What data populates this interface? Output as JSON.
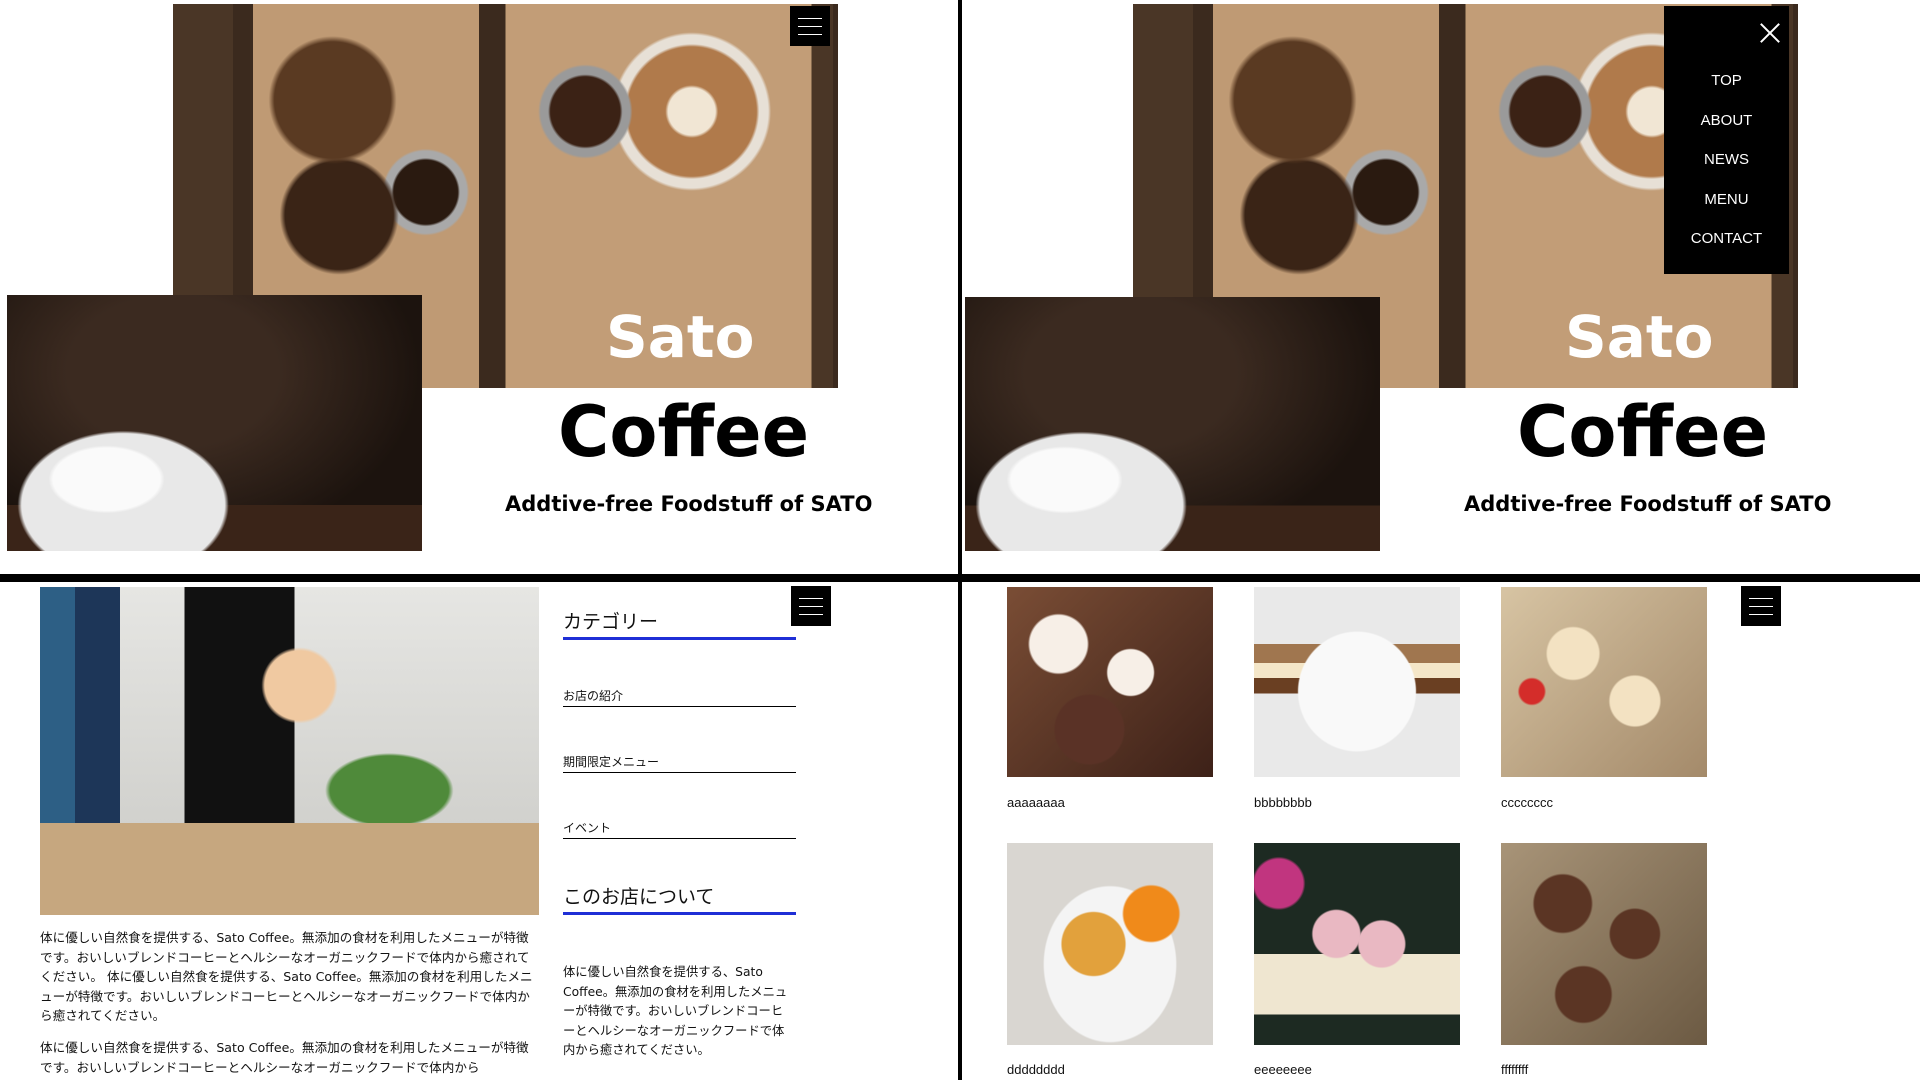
{
  "hero": {
    "title_line1": "Sato",
    "title_line2": "Coffee",
    "tagline": "Addtive-free Foodstuff of SATO"
  },
  "nav": {
    "items": [
      "TOP",
      "ABOUT",
      "NEWS",
      "MENU",
      "CONTACT"
    ]
  },
  "sidebar": {
    "category_heading": "カテゴリー",
    "links": [
      "お店の紹介",
      "期間限定メニュー",
      "イベント"
    ],
    "about_heading": "このお店について",
    "about_text": "体に優しい自然食を提供する、Sato Coffee。無添加の食材を利用したメニューが特徴です。おいしいブレンドコーヒーとヘルシーなオーガニックフードで体内から癒されてください。"
  },
  "article": {
    "paragraph1": "体に優しい自然食を提供する、Sato Coffee。無添加の食材を利用したメニューが特徴です。おいしいブレンドコーヒーとヘルシーなオーガニックフードで体内から癒されてください。 体に優しい自然食を提供する、Sato Coffee。無添加の食材を利用したメニューが特徴です。おいしいブレンドコーヒーとヘルシーなオーガニックフードで体内から癒されてください。",
    "paragraph2": "体に優しい自然食を提供する、Sato Coffee。無添加の食材を利用したメニューが特徴です。おいしいブレンドコーヒーとヘルシーなオーガニックフードで体内から"
  },
  "gallery": {
    "captions": [
      "aaaaaaaa",
      "bbbbbbbb",
      "cccccccc",
      "dddddddd",
      "eeeeeeee",
      "ffffffff"
    ]
  }
}
